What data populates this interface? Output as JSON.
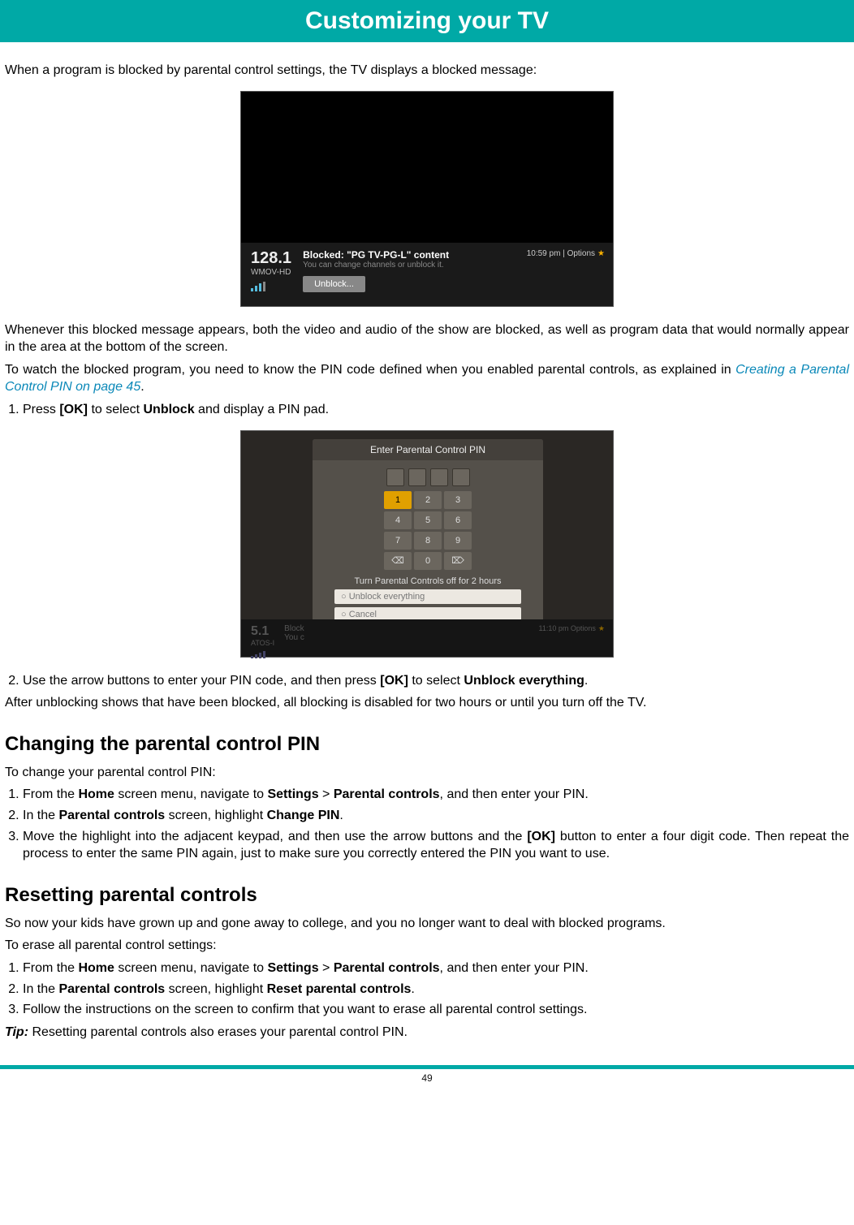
{
  "banner": {
    "title": "Customizing your TV"
  },
  "intro": {
    "p1": "When a program is blocked by parental control settings, the TV displays a blocked message:",
    "p2": "Whenever this blocked message appears, both the video and audio of the show are blocked, as well as program data that would normally appear in the area at the bottom of the screen.",
    "p3a": "To watch the blocked program, you need to know the PIN code defined when you enabled parental controls, as explained in ",
    "linktext": "Creating a Parental Control PIN on page 45",
    "p3b": ".",
    "step1a": "Press ",
    "ok": "[OK]",
    "step1b": " to select ",
    "unblock": "Unblock",
    "step1c": " and display a PIN pad.",
    "step2a": "Use the arrow buttons to enter your PIN code, and then press ",
    "step2b": " to select ",
    "unblockeverything": "Unblock everything",
    "step2c": ".",
    "p4": "After unblocking shows that have been blocked, all blocking is disabled for two hours or until you turn off the TV."
  },
  "shot1": {
    "channel": "128.1",
    "callsign": "WMOV-HD",
    "title": "Blocked: \"PG TV-PG-L\" content",
    "sub": "You can change channels or unblock it.",
    "button": "Unblock...",
    "clock": "10:59 pm  |  Options"
  },
  "shot2": {
    "dialogtitle": "Enter Parental Control PIN",
    "keys": [
      "1",
      "2",
      "3",
      "4",
      "5",
      "6",
      "7",
      "8",
      "9",
      "⌫",
      "0",
      "⌦"
    ],
    "caption": "Turn Parental Controls off for 2 hours",
    "opt1": "Unblock everything",
    "opt2": "Cancel",
    "channel": "5.1",
    "callsign": "ATOS-I",
    "msg": "Block",
    "sub": "You c",
    "clock": "11:10 pm   Options"
  },
  "changing": {
    "heading": "Changing the parental control PIN",
    "p": "To change your parental control PIN:",
    "s1a": "From the ",
    "home": "Home",
    "s1b": " screen menu, navigate to ",
    "settings": "Settings",
    "gt": " > ",
    "parental": "Parental controls",
    "s1c": ", and then enter your PIN.",
    "s2a": "In the ",
    "s2b": " screen, highlight ",
    "changepin": "Change PIN",
    "s2c": ".",
    "s3a": "Move the highlight into the adjacent keypad, and then use the arrow buttons and the ",
    "s3b": " button to enter a four digit code. Then repeat the process to enter the same PIN again, just to make sure you correctly entered the PIN you want to use."
  },
  "resetting": {
    "heading": "Resetting parental controls",
    "p1": "So now your kids have grown up and gone away to college, and you no longer want to deal with blocked programs.",
    "p2": "To erase all parental control settings:",
    "s1a": "From the ",
    "s1b": " screen menu, navigate to ",
    "s1c": ", and then enter your PIN.",
    "s2a": "In the ",
    "s2b": " screen, highlight ",
    "resetpc": "Reset parental controls",
    "s2c": ".",
    "s3": "Follow the instructions on the screen to confirm that you want to erase all parental control settings.",
    "tiplabel": "Tip:",
    "tiptext": " Resetting parental controls also erases your parental control PIN."
  },
  "page": "49"
}
